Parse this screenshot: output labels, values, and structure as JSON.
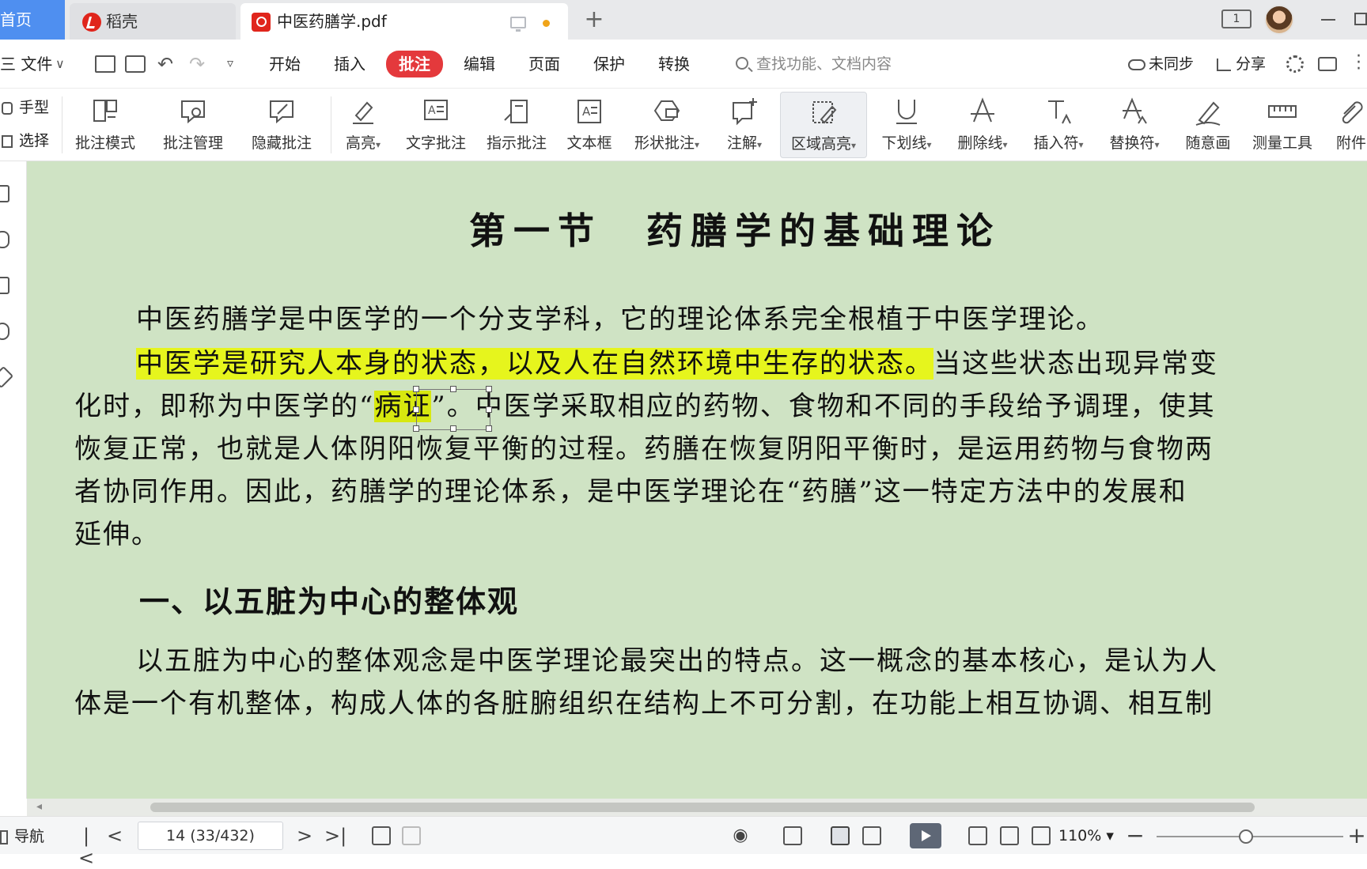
{
  "tabs": {
    "home": "首页",
    "docer": "稻壳",
    "pdf": "中医药膳学.pdf",
    "add": "+"
  },
  "menu": {
    "file": "三 文件",
    "items": [
      "开始",
      "插入",
      "批注",
      "编辑",
      "页面",
      "保护",
      "转换"
    ],
    "active": "批注",
    "search_placeholder": "查找功能、文档内容",
    "sync": "未同步",
    "share": "分享"
  },
  "ribbon": {
    "hand": "手型",
    "select": "选择",
    "buttons": [
      "批注模式",
      "批注管理",
      "隐藏批注",
      "高亮",
      "文字批注",
      "指示批注",
      "文本框",
      "形状批注",
      "注解",
      "区域高亮",
      "下划线",
      "删除线",
      "插入符",
      "替换符",
      "随意画",
      "测量工具",
      "附件"
    ]
  },
  "document": {
    "title": "第一节　药膳学的基础理论",
    "p1": "中医药膳学是中医学的一个分支学科，它的理论体系完全根植于中医学理论。",
    "p2_highlight": "中医学是研究人本身的状态，以及人在自然环境中生存的状态。",
    "p2_rest": "当这些状态出现异常变",
    "p3_pre": "化时，即称为中医学的“",
    "p3_sel": "病证",
    "p3_post": "”。中医学采取相应的药物、食物和不同的手段给予调理，使其",
    "p4": "恢复正常，也就是人体阴阳恢复平衡的过程。药膳在恢复阴阳平衡时，是运用药物与食物两",
    "p5": "者协同作用。因此，药膳学的理论体系，是中医学理论在“药膳”这一特定方法中的发展和",
    "p6": "延伸。",
    "heading": "一、以五脏为中心的整体观",
    "p7": "以五脏为中心的整体观念是中医学理论最突出的特点。这一概念的基本核心，是认为人",
    "p8": "体是一个有机整体，构成人体的各脏腑组织在结构上不可分割，在功能上相互协调、相互制"
  },
  "status": {
    "nav": "导航",
    "page": "14 (33/432)",
    "zoom": "110%"
  },
  "colors": {
    "accent": "#e4393c",
    "home_tab": "#4f8ff0",
    "page_bg": "#cfe3c4",
    "highlight": "#e6f51d"
  }
}
